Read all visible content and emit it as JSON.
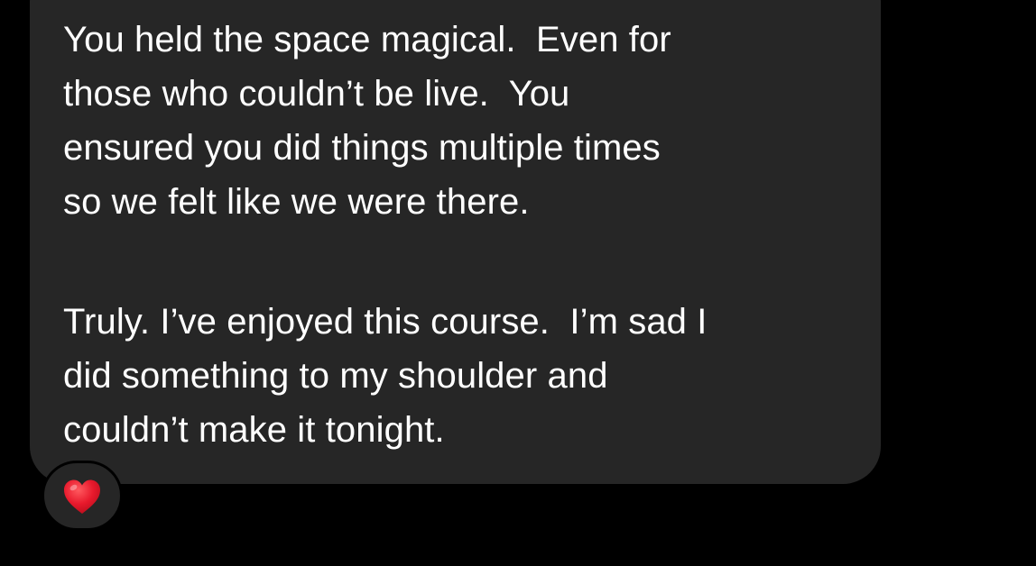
{
  "message": {
    "paragraph1": "You held the space magical.  Even for\nthose who couldn’t be live.  You\nensured you did things multiple times\nso we felt like we were there.",
    "paragraph2": "Truly. I’ve enjoyed this course.  I’m sad I\ndid something to my shoulder and\ncouldn’t make it tonight."
  },
  "reaction": {
    "icon": "red-heart-icon",
    "color": "#e8192c"
  },
  "colors": {
    "background": "#000000",
    "bubble": "#262626",
    "text": "#ffffff"
  }
}
